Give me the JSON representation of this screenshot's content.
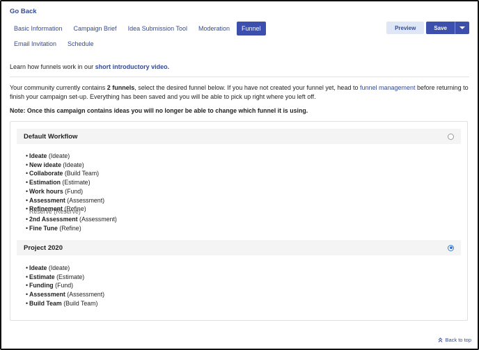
{
  "nav": {
    "go_back": "Go Back"
  },
  "tabs": [
    {
      "label": "Basic Information",
      "active": false
    },
    {
      "label": "Campaign Brief",
      "active": false
    },
    {
      "label": "Idea Submission Tool",
      "active": false
    },
    {
      "label": "Moderation",
      "active": false
    },
    {
      "label": "Funnel",
      "active": true
    },
    {
      "label": "Email Invitation",
      "active": false
    },
    {
      "label": "Schedule",
      "active": false
    }
  ],
  "toolbar": {
    "preview_label": "Preview",
    "save_label": "Save",
    "caret_icon": "chevron-down-icon"
  },
  "intro": {
    "text": "Learn how funnels work in our ",
    "link": "short introductory video."
  },
  "description": {
    "part1": "Your community currently contains ",
    "count": "2 funnels",
    "part2": ", select the desired funnel below. If you have not created your funnel yet, head to ",
    "link": "funnel management",
    "part3": " before returning to finish your campaign set-up. Everything has been saved and you will be able to pick up right where you left off."
  },
  "note": "Note: Once this campaign contains ideas you will no longer be able to change which funnel it is using.",
  "workflows": [
    {
      "title": "Default Workflow",
      "selected": false,
      "stages": [
        {
          "name": "Ideate",
          "type": "(Ideate)"
        },
        {
          "name": "New ideate",
          "type": "(Ideate)"
        },
        {
          "name": "Collaborate",
          "type": "(Build Team)"
        },
        {
          "name": "Estimation",
          "type": "(Estimate)"
        },
        {
          "name": "Work hours",
          "type": "(Fund)"
        },
        {
          "name": "Assessment",
          "type": "(Assessment)"
        },
        {
          "name": "Refinement",
          "type": "(Refine)",
          "overlap": "Reserve (Reserve)"
        },
        {
          "name": "2nd Assessment",
          "type": "(Assessment)"
        },
        {
          "name": "Fine Tune",
          "type": "(Refine)"
        }
      ]
    },
    {
      "title": "Project 2020",
      "selected": true,
      "stages": [
        {
          "name": "Ideate",
          "type": "(Ideate)"
        },
        {
          "name": "Estimate",
          "type": "(Estimate)"
        },
        {
          "name": "Funding",
          "type": "(Fund)"
        },
        {
          "name": "Assessment",
          "type": "(Assessment)"
        },
        {
          "name": "Build Team",
          "type": "(Build Team)"
        }
      ]
    }
  ],
  "footer": {
    "back_to_top": "Back to top",
    "icon": "double-chevron-up-icon"
  }
}
